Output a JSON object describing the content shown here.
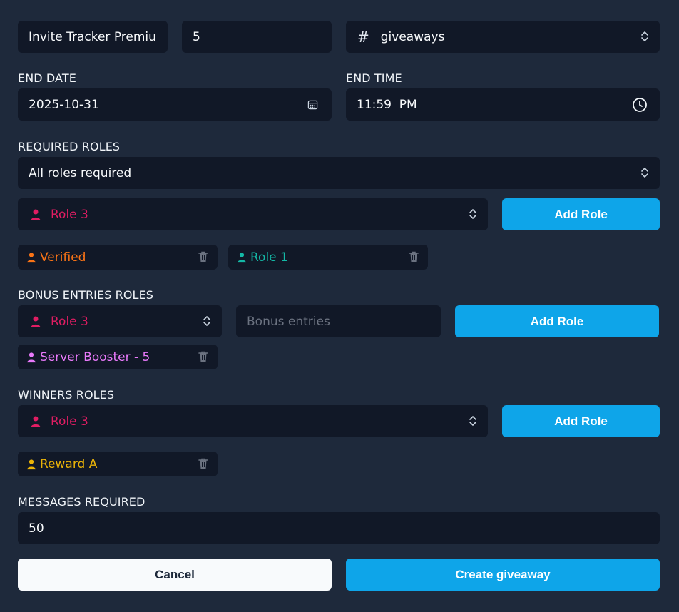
{
  "form": {
    "prize_value": "Invite Tracker Premiu",
    "winners_value": "5",
    "channel": {
      "prefix": "#",
      "value": "giveaways"
    },
    "end_date": {
      "label": "END DATE",
      "value": "2025-10-31"
    },
    "end_time": {
      "label": "END TIME",
      "value": "11:59  PM"
    },
    "required_roles": {
      "label": "REQUIRED ROLES",
      "mode_value": "All roles required",
      "role_select_value": "Role 3",
      "add_button": "Add Role",
      "chips": [
        {
          "label": "Verified",
          "color": "#f97316"
        },
        {
          "label": "Role 1",
          "color": "#14b8a6"
        }
      ]
    },
    "bonus_roles": {
      "label": "BONUS ENTRIES ROLES",
      "role_select_value": "Role 3",
      "entries_placeholder": "Bonus entries",
      "add_button": "Add Role",
      "chips": [
        {
          "label": "Server Booster - 5",
          "color": "#e879f9"
        }
      ]
    },
    "winners_roles": {
      "label": "WINNERS ROLES",
      "role_select_value": "Role 3",
      "add_button": "Add Role",
      "chips": [
        {
          "label": "Reward A",
          "color": "#eab308"
        }
      ]
    },
    "messages": {
      "label": "MESSAGES REQUIRED",
      "value": "50"
    },
    "cancel_button": "Cancel",
    "create_button": "Create giveaway"
  },
  "colors": {
    "background": "#1e293b",
    "field": "#111827",
    "accent": "#0ea5e9",
    "role_select": "#e11d63"
  },
  "icons": {
    "select": "chevron-up-down-icon",
    "date": "calendar-icon",
    "time": "clock-icon",
    "role": "person-icon",
    "remove": "trash-icon"
  }
}
